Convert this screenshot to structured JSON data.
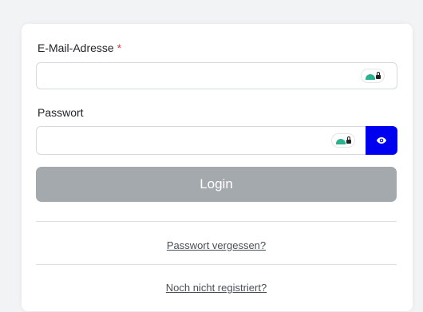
{
  "form": {
    "email_label": "E-Mail-Adresse",
    "email_required_marker": "*",
    "email_value": "",
    "password_label": "Passwort",
    "password_value": "",
    "login_label": "Login",
    "forgot_password_link": "Passwort vergessen?",
    "register_link": "Noch nicht registriert?"
  },
  "icons": {
    "password_manager": "password-manager-icon",
    "show_password": "eye-icon"
  },
  "colors": {
    "required": "#dc3545",
    "eye_button": "#0000f0",
    "login_button_disabled": "#a4a9ae"
  }
}
